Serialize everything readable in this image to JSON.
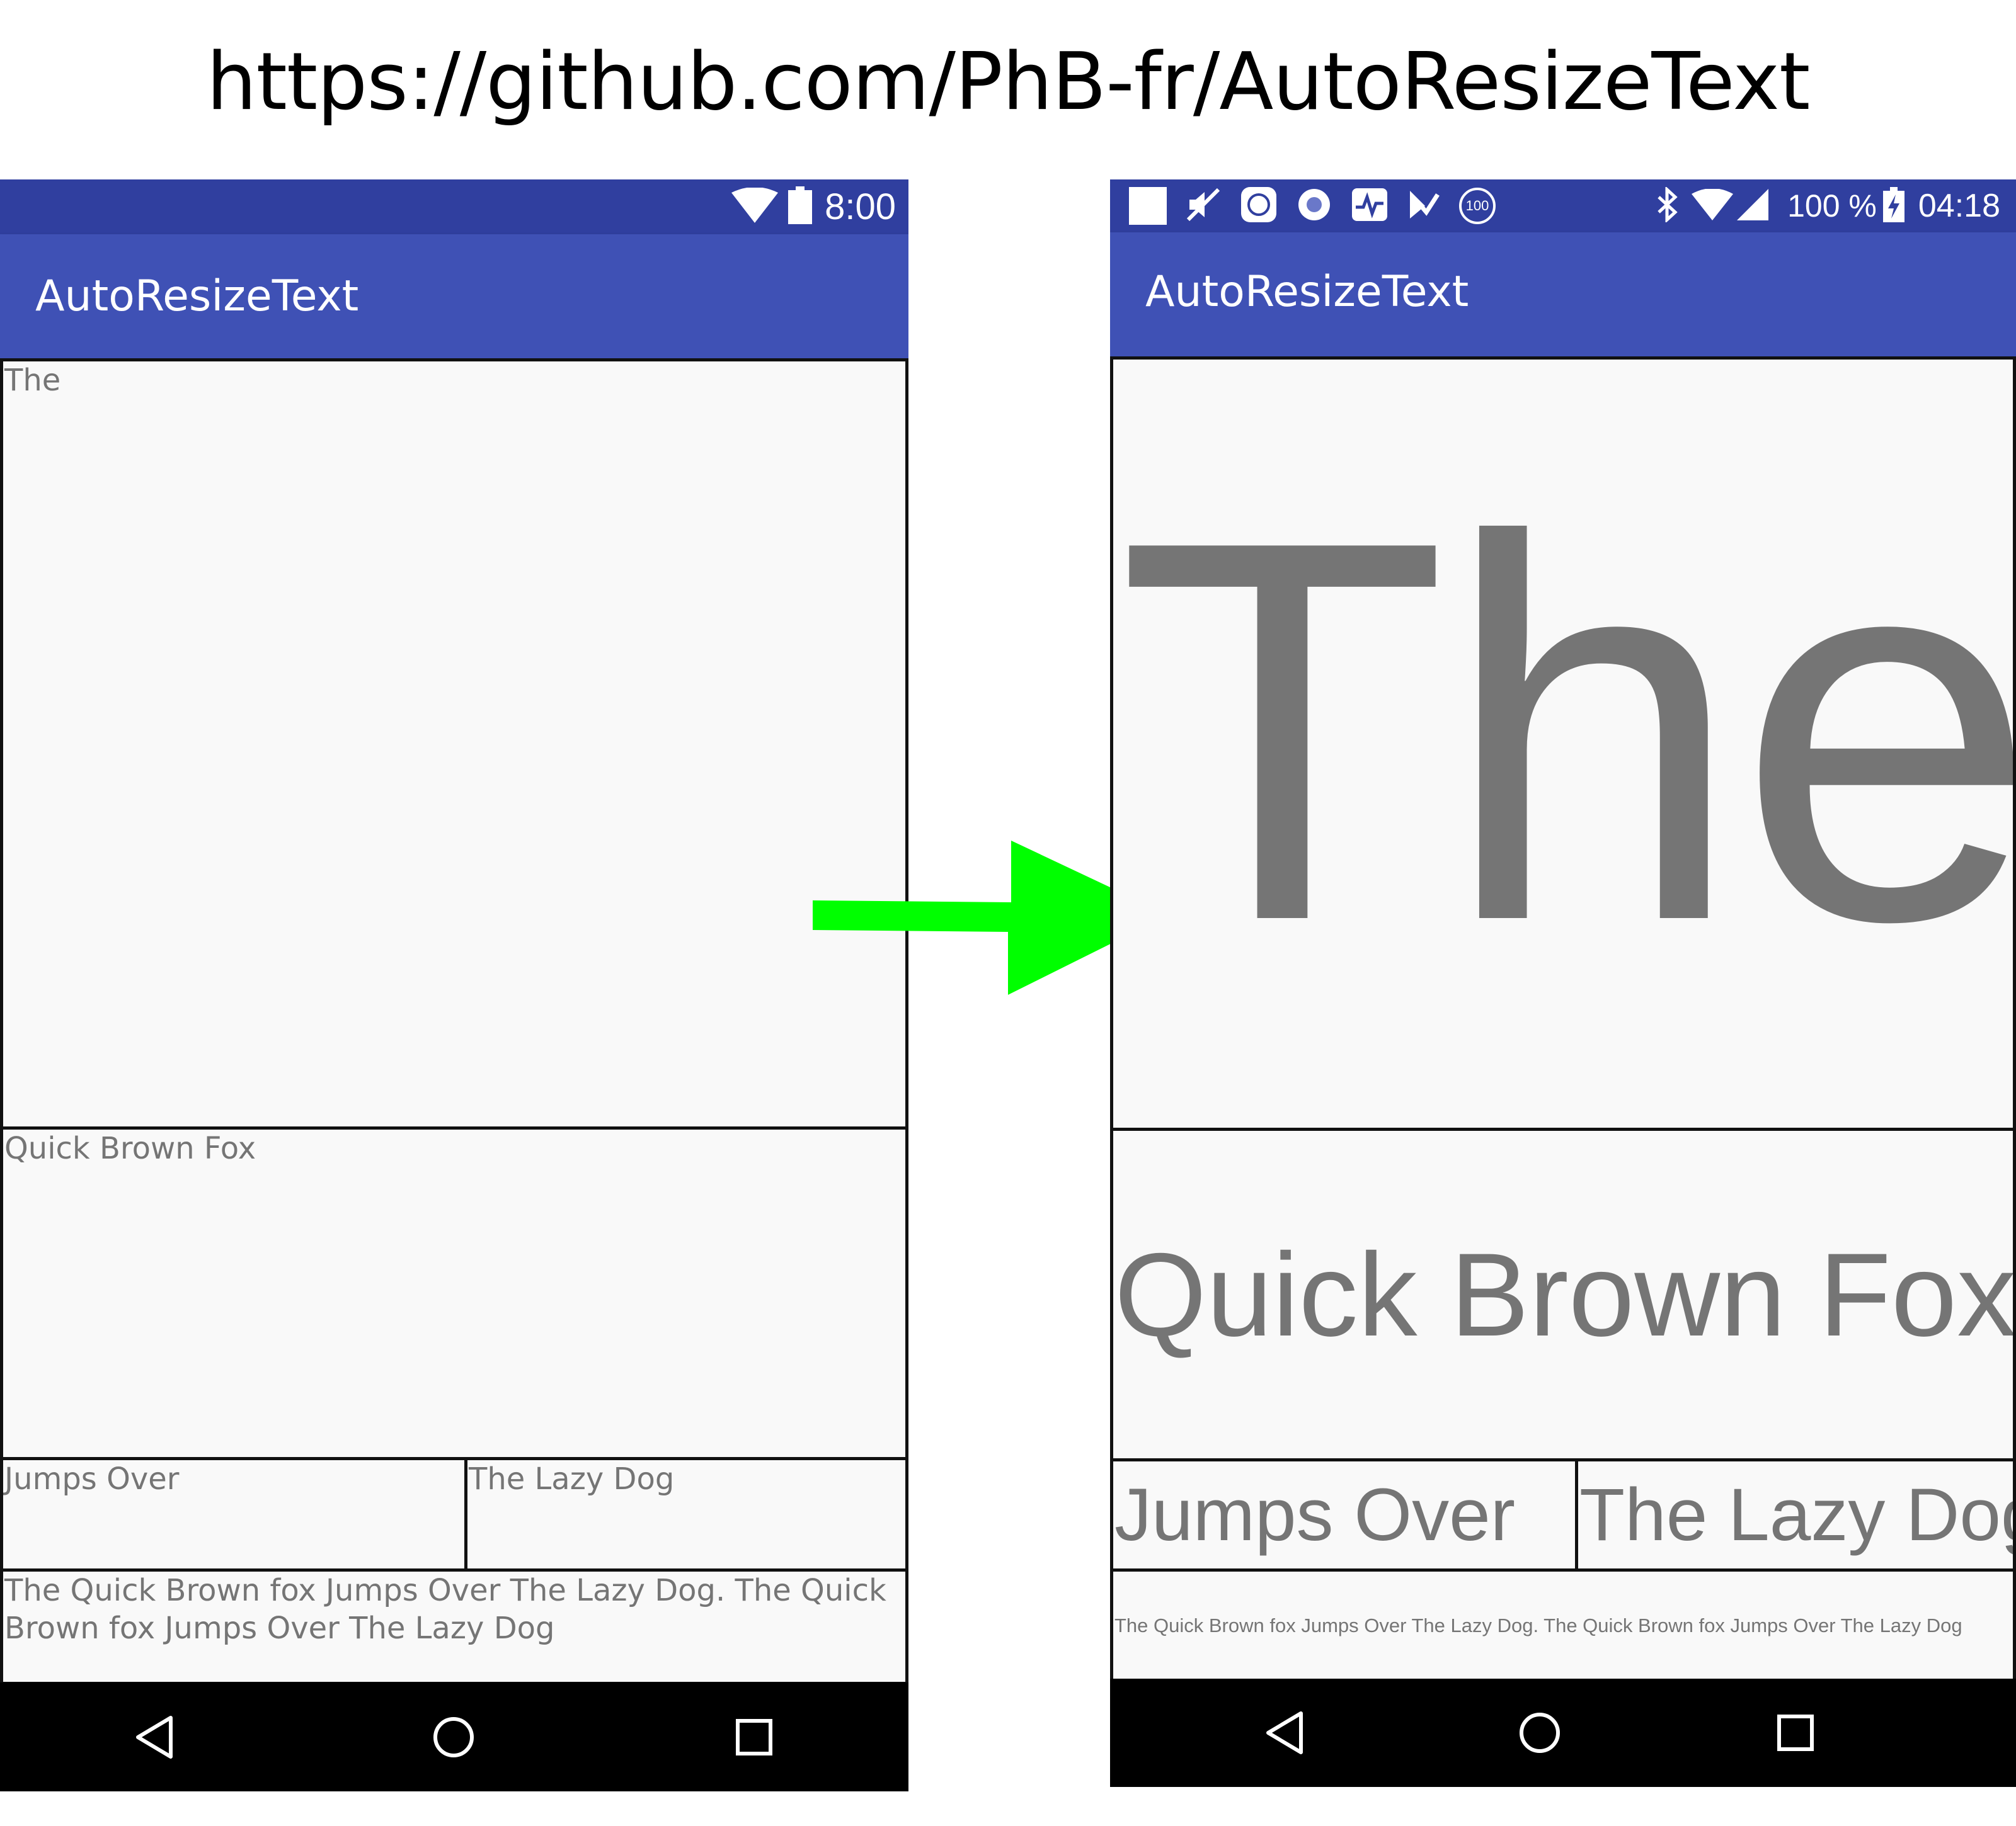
{
  "header": {
    "url": "https://github.com/PhB-fr/AutoResizeText"
  },
  "left_phone": {
    "status_bar": {
      "time": "8:00",
      "icons": [
        "wifi-icon",
        "battery-icon"
      ]
    },
    "app_bar": {
      "title": "AutoResizeText"
    },
    "text_views": {
      "the": "The",
      "quick_brown_fox": "Quick Brown Fox",
      "jumps_over": "Jumps Over",
      "the_lazy_dog": "The Lazy Dog",
      "long_sentence": "The Quick Brown fox Jumps Over The Lazy Dog. The Quick Brown fox Jumps Over The Lazy Dog"
    },
    "nav_bar": {
      "buttons": [
        "back-icon",
        "home-icon",
        "recents-icon"
      ]
    }
  },
  "right_phone": {
    "status_bar": {
      "time": "04:18",
      "battery_percent": "100 %",
      "notification_badge": "100",
      "notification_icons": [
        "square-icon",
        "muted-speaker-icon",
        "mi-app-icon",
        "record-icon",
        "activity-icon",
        "task-check-icon",
        "badge-100-icon"
      ],
      "system_icons": [
        "bluetooth-icon",
        "wifi-icon",
        "cell-signal-icon",
        "battery-charging-icon"
      ]
    },
    "app_bar": {
      "title": "AutoResizeText"
    },
    "text_views": {
      "the": "The",
      "quick_brown_fox": "Quick Brown Fox",
      "jumps_over": "Jumps Over",
      "the_lazy_dog": "The Lazy Dog",
      "long_sentence": "The Quick Brown fox Jumps Over The Lazy Dog. The Quick Brown fox Jumps Over The Lazy Dog"
    },
    "nav_bar": {
      "buttons": [
        "back-icon",
        "home-icon",
        "recents-icon"
      ]
    }
  },
  "arrow": {
    "icon": "right-arrow-icon",
    "color": "#00ff00"
  },
  "colors": {
    "status_bar": "#303f9f",
    "app_bar": "#3f51b5",
    "content_background": "#f9f9f9",
    "text_gray": "#757575",
    "nav_bar": "#000000"
  }
}
